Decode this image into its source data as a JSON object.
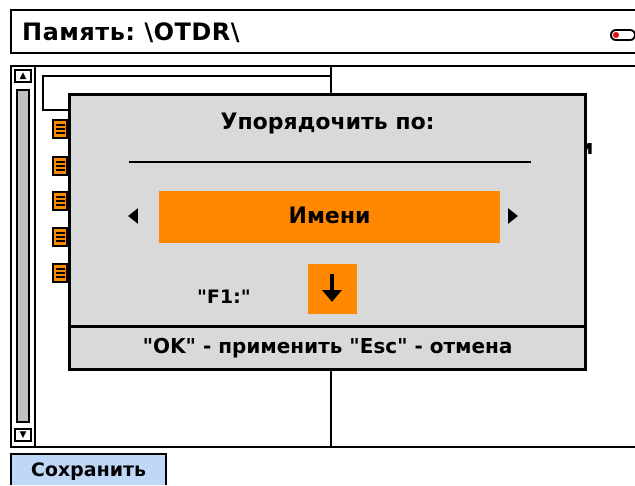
{
  "header": {
    "title": "Память: \\OTDR\\",
    "battery_icon": "battery-icon",
    "battery_color": "#e01010"
  },
  "filelist": {
    "file_icon": "document-icon",
    "file_count": 5,
    "right_column_fragment": "м"
  },
  "dialog": {
    "title": "Упорядочить по:",
    "selected_option": "Имени",
    "f1_label": "\"F1:\"",
    "f1_icon": "arrow-down-icon",
    "hint": "\"OK\" - применить \"Esc\" - отмена"
  },
  "footer": {
    "save_label": "Сохранить"
  },
  "colors": {
    "accent": "#ff8800",
    "dialog_bg": "#d9d9d9",
    "button_bg": "#c0d8f8"
  }
}
